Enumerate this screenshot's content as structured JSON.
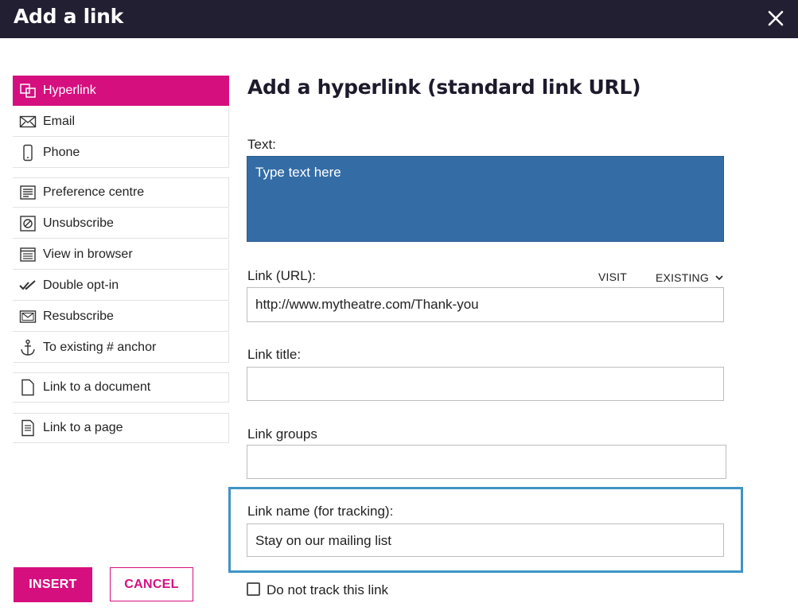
{
  "dialog": {
    "title": "Add a link",
    "close_icon": "close-icon"
  },
  "sidebar": {
    "items": [
      {
        "label": "Hyperlink",
        "icon": "hyperlink-icon",
        "active": true
      },
      {
        "label": "Email",
        "icon": "envelope-icon"
      },
      {
        "label": "Phone",
        "icon": "phone-icon"
      },
      {
        "label": "Preference centre",
        "icon": "preference-list-icon"
      },
      {
        "label": "Unsubscribe",
        "icon": "unsubscribe-icon"
      },
      {
        "label": "View in browser",
        "icon": "browser-window-icon"
      },
      {
        "label": "Double opt-in",
        "icon": "double-check-icon"
      },
      {
        "label": "Resubscribe",
        "icon": "resubscribe-envelope-icon"
      },
      {
        "label": "To existing # anchor",
        "icon": "anchor-icon"
      },
      {
        "label": "Link to a document",
        "icon": "document-icon"
      },
      {
        "label": "Link to a page",
        "icon": "page-icon"
      }
    ]
  },
  "main": {
    "heading": "Add a hyperlink (standard link URL)",
    "text_label": "Text:",
    "text_placeholder": "Type text here",
    "url_label": "Link (URL):",
    "visit_label": "VISIT",
    "existing_label": "EXISTING",
    "url_value": "http://www.mytheatre.com/Thank-you",
    "title_label": "Link title:",
    "title_value": "",
    "groups_label": "Link groups",
    "groups_value": "",
    "name_label": "Link name (for tracking):",
    "name_value": "Stay on our mailing list",
    "no_track_label": "Do not track this link"
  },
  "footer": {
    "insert_label": "INSERT",
    "cancel_label": "CANCEL"
  },
  "colors": {
    "accent": "#d60f7f",
    "header_bg": "#221f33",
    "text_field_bg": "#346da6",
    "highlight_border": "#3f93c5"
  }
}
